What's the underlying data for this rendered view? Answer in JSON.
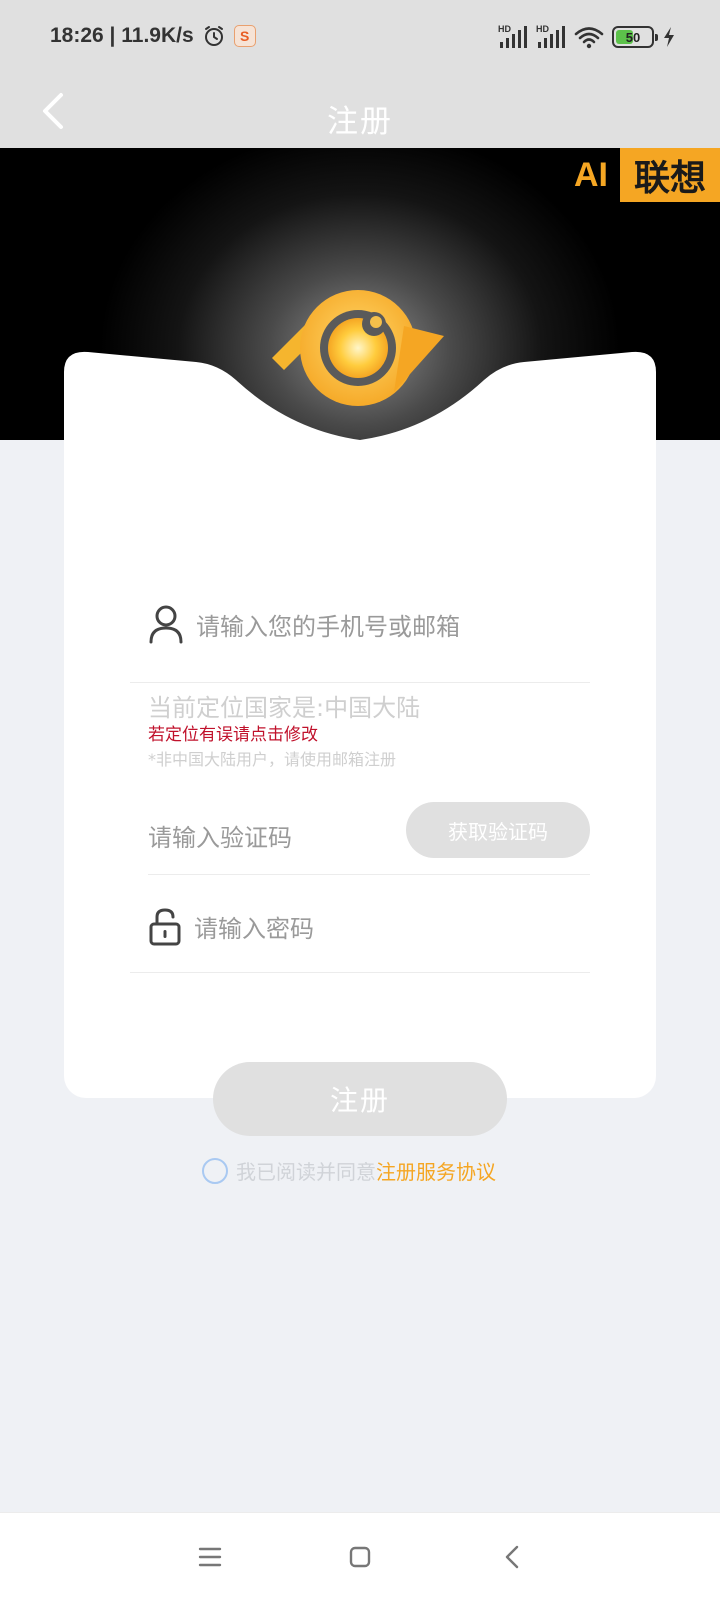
{
  "status": {
    "time_speed": "18:26 | 11.9K/s",
    "app_badge": "S",
    "hd_label": "HD",
    "battery": "50",
    "battery_level": 0.5
  },
  "header": {
    "title": "注册"
  },
  "brand": {
    "ai": "AI",
    "name": "联想"
  },
  "form": {
    "phone_placeholder": "请输入您的手机号或邮箱",
    "location": "当前定位国家是:中国大陆",
    "location_error": "若定位有误请点击修改",
    "email_hint": "*非中国大陆用户，请使用邮箱注册",
    "code_placeholder": "请输入验证码",
    "get_code": "获取验证码",
    "password_placeholder": "请输入密码",
    "register": "注册"
  },
  "agreement": {
    "text": "我已阅读并同意",
    "link": "注册服务协议"
  },
  "colors": {
    "accent": "#f5a623",
    "error": "#c0112b",
    "header_bg": "#e0e0e0",
    "page_bg": "#eff1f5"
  },
  "icons": [
    "back-icon",
    "alarm-icon",
    "signal-icon",
    "wifi-icon",
    "battery-icon",
    "charging-icon",
    "user-icon",
    "lock-icon",
    "menu-icon",
    "home-icon",
    "nav-back-icon"
  ]
}
